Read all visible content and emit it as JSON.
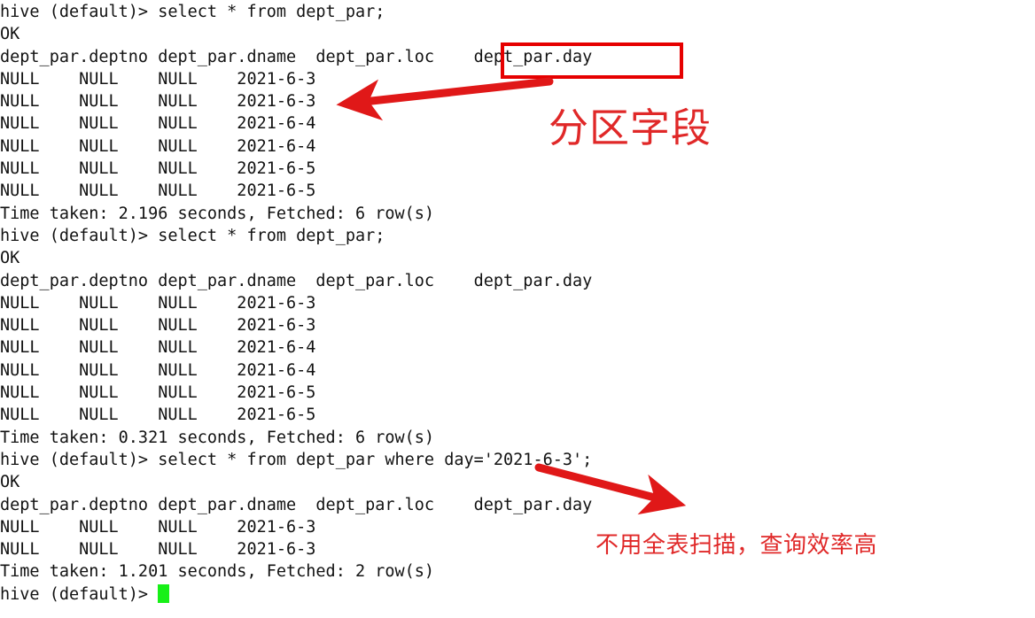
{
  "terminal": {
    "prompt": "hive (default)> ",
    "lines": [
      "hive (default)> select * from dept_par;",
      "OK",
      "dept_par.deptno dept_par.dname  dept_par.loc    dept_par.day",
      "NULL    NULL    NULL    2021-6-3",
      "NULL    NULL    NULL    2021-6-3",
      "NULL    NULL    NULL    2021-6-4",
      "NULL    NULL    NULL    2021-6-4",
      "NULL    NULL    NULL    2021-6-5",
      "NULL    NULL    NULL    2021-6-5",
      "Time taken: 2.196 seconds, Fetched: 6 row(s)",
      "hive (default)> select * from dept_par;",
      "OK",
      "dept_par.deptno dept_par.dname  dept_par.loc    dept_par.day",
      "NULL    NULL    NULL    2021-6-3",
      "NULL    NULL    NULL    2021-6-3",
      "NULL    NULL    NULL    2021-6-4",
      "NULL    NULL    NULL    2021-6-4",
      "NULL    NULL    NULL    2021-6-5",
      "NULL    NULL    NULL    2021-6-5",
      "Time taken: 0.321 seconds, Fetched: 6 row(s)",
      "hive (default)> select * from dept_par where day='2021-6-3';",
      "OK",
      "dept_par.deptno dept_par.dname  dept_par.loc    dept_par.day",
      "NULL    NULL    NULL    2021-6-3",
      "NULL    NULL    NULL    2021-6-3",
      "Time taken: 1.201 seconds, Fetched: 2 row(s)"
    ],
    "last_prompt": "hive (default)> ",
    "cursor_color": "#17f017",
    "text_color": "#121212",
    "background_color": "#ffffff"
  },
  "annotations": {
    "accent_color": "#e60000",
    "note_color": "#e02828",
    "highlight_box_label": "dept_par.day",
    "note_partition_field": "分区字段",
    "note_no_full_scan": "不用全表扫描，查询效率高"
  }
}
